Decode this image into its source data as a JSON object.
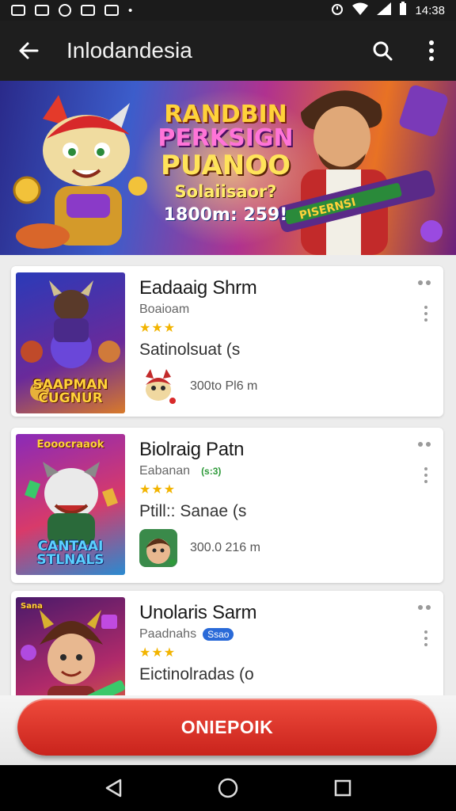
{
  "status_bar": {
    "time": "14:38"
  },
  "app_bar": {
    "title": "Inlodandesia"
  },
  "banner": {
    "lines": [
      "RANDBIN",
      "PERKSIGN",
      "PUANOO",
      "Solaiisaor?",
      "1800m: 259!"
    ],
    "weapon_text": "PISERNSI"
  },
  "cards": [
    {
      "title": "Eadaaig Shrm",
      "subtitle": "Boaioam",
      "tag": "",
      "rating": "★★★",
      "description": "Satinolsuat (s",
      "developer_text": "300to Pl6 m",
      "thumb_top": "",
      "thumb_caption": "SAAPMAN CUGNUR",
      "accent": "#3a2a8a"
    },
    {
      "title": "Biolraig Patn",
      "subtitle": "Eabanan",
      "tag": "(s:3)",
      "rating": "★★★",
      "description": "Ptill:: Sanae (s",
      "developer_text": "300.0 216 m",
      "thumb_top": "Eooocraaok",
      "thumb_caption": "CANTAAI STLNALS",
      "accent": "#7a3aa0"
    },
    {
      "title": "Unolaris Sarm",
      "subtitle": "Paadnahs",
      "tag": "Ssao",
      "rating": "★★★",
      "description": "Eictinolradas (o",
      "developer_text": "",
      "thumb_top": "Sana",
      "thumb_caption": "",
      "accent": "#a02a6a"
    }
  ],
  "cta": {
    "label": "ONIEPOIK"
  },
  "colors": {
    "cta": "#d8342a",
    "star": "#f2b400",
    "app_bar": "#1e1e1e",
    "tag_green": "#2e9a3a",
    "tag_blue": "#2a6ad8"
  },
  "icons": [
    "back-arrow-icon",
    "search-icon",
    "more-vert-icon",
    "nav-back-icon",
    "nav-home-icon",
    "nav-recents-icon"
  ]
}
